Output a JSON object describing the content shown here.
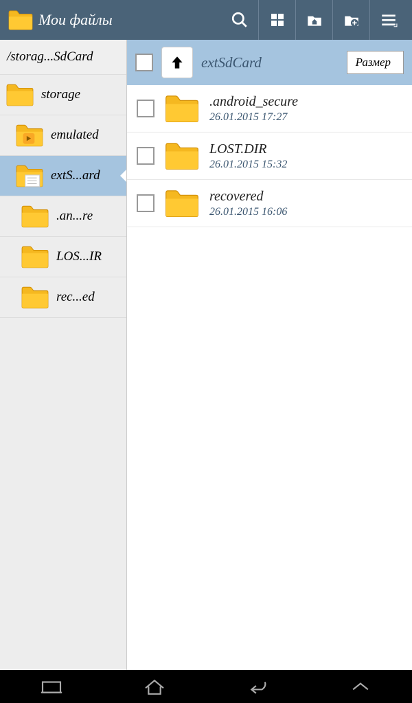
{
  "header": {
    "title": "Мои файлы"
  },
  "sidebar": {
    "path": "/storag...SdCard",
    "items": [
      {
        "label": "storage",
        "selected": false,
        "indented": false,
        "hasNote": false
      },
      {
        "label": "emulated",
        "selected": false,
        "indented": true,
        "hasNote": false,
        "hasArrow": true
      },
      {
        "label": "extS...ard",
        "selected": true,
        "indented": true,
        "hasNote": true
      },
      {
        "label": ".an...re",
        "selected": false,
        "indented": true,
        "hasNote": false,
        "deep": true
      },
      {
        "label": "LOS...IR",
        "selected": false,
        "indented": true,
        "hasNote": false,
        "deep": true
      },
      {
        "label": "rec...ed",
        "selected": false,
        "indented": true,
        "hasNote": false,
        "deep": true
      }
    ]
  },
  "main": {
    "currentFolder": "extSdCard",
    "sortLabel": "Размер",
    "files": [
      {
        "name": ".android_secure",
        "date": "26.01.2015 17:27"
      },
      {
        "name": "LOST.DIR",
        "date": "26.01.2015 15:32"
      },
      {
        "name": "recovered",
        "date": "26.01.2015 16:06"
      }
    ]
  }
}
